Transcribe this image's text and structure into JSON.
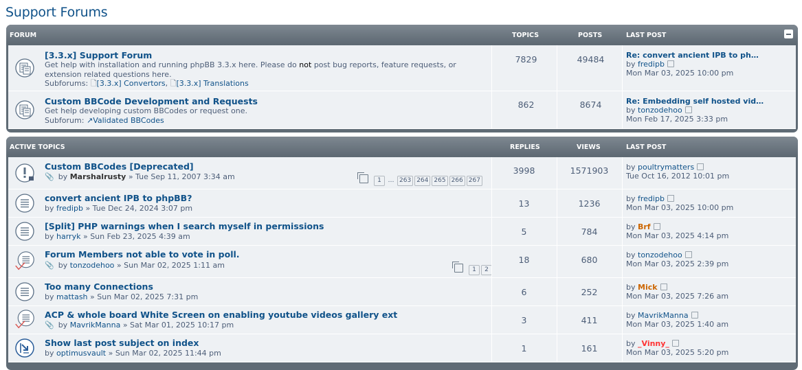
{
  "page": {
    "title": "Support Forums"
  },
  "forums_panel": {
    "headers": {
      "forum": "FORUM",
      "topics": "TOPICS",
      "posts": "POSTS",
      "last_post": "LAST POST"
    },
    "rows": [
      {
        "title": "[3.3.x] Support Forum",
        "desc1": "Get help with installation and running phpBB 3.3.x here. Please do",
        "desc_not": "not",
        "desc1b": "post bug reports, feature requests, or",
        "desc2": "extension related questions here.",
        "sub_label": "Subforums:",
        "sub1": "[3.3.x] Convertors",
        "sub_sep": ",",
        "sub2": "[3.3.x] Translations",
        "topics": "7829",
        "posts": "49484",
        "lp_title": "Re: convert ancient IPB to ph…",
        "lp_by": "by",
        "lp_user": "fredipb",
        "lp_date": "Mon Mar 03, 2025 10:00 pm"
      },
      {
        "title": "Custom BBCode Development and Requests",
        "desc1": "Get help developing custom BBCodes or request one.",
        "sub_label": "Subforum:",
        "sub1": "Validated BBCodes",
        "topics": "862",
        "posts": "8674",
        "lp_title": "Re: Embedding self hosted vid…",
        "lp_by": "by",
        "lp_user": "tonzodehoo",
        "lp_date": "Mon Feb 17, 2025 3:33 pm"
      }
    ]
  },
  "topics_panel": {
    "headers": {
      "active": "ACTIVE TOPICS",
      "replies": "REPLIES",
      "views": "VIEWS",
      "last_post": "LAST POST"
    },
    "rows": [
      {
        "title": "Custom BBCodes [Deprecated]",
        "by": "by",
        "author": "Marshalrusty",
        "sep": "»",
        "date": "Tue Sep 11, 2007 3:34 am",
        "pages": [
          "1",
          "…",
          "263",
          "264",
          "265",
          "266",
          "267"
        ],
        "replies": "3998",
        "views": "1571903",
        "lp_by": "by",
        "lp_user": "poultrymatters",
        "lp_date": "Tue Oct 16, 2012 10:01 pm"
      },
      {
        "title": "convert ancient IPB to phpBB?",
        "by": "by",
        "author": "fredipb",
        "sep": "»",
        "date": "Tue Dec 24, 2024 3:07 pm",
        "replies": "13",
        "views": "1236",
        "lp_by": "by",
        "lp_user": "fredipb",
        "lp_date": "Mon Mar 03, 2025 10:00 pm"
      },
      {
        "title": "[Split] PHP warnings when I search myself in permissions",
        "by": "by",
        "author": "harryk",
        "sep": "»",
        "date": "Sun Feb 23, 2025 4:39 am",
        "replies": "5",
        "views": "784",
        "lp_by": "by",
        "lp_user": "Brf",
        "lp_date": "Mon Mar 03, 2025 4:14 pm"
      },
      {
        "title": "Forum Members not able to vote in poll.",
        "by": "by",
        "author": "tonzodehoo",
        "sep": "»",
        "date": "Sun Mar 02, 2025 1:11 am",
        "pages": [
          "1",
          "2"
        ],
        "replies": "18",
        "views": "680",
        "lp_by": "by",
        "lp_user": "tonzodehoo",
        "lp_date": "Mon Mar 03, 2025 2:39 pm"
      },
      {
        "title": "Too many Connections",
        "by": "by",
        "author": "mattash",
        "sep": "»",
        "date": "Sun Mar 02, 2025 7:31 pm",
        "replies": "6",
        "views": "252",
        "lp_by": "by",
        "lp_user": "Mick",
        "lp_date": "Mon Mar 03, 2025 7:26 am"
      },
      {
        "title": "ACP & whole board White Screen on enabling youtube videos gallery ext",
        "by": "by",
        "author": "MavrikManna",
        "sep": "»",
        "date": "Sat Mar 01, 2025 10:17 pm",
        "replies": "3",
        "views": "411",
        "lp_by": "by",
        "lp_user": "MavrikManna",
        "lp_date": "Mon Mar 03, 2025 1:40 am"
      },
      {
        "title": "Show last post subject on index",
        "by": "by",
        "author": "optimusvault",
        "sep": "»",
        "date": "Sun Mar 02, 2025 11:44 pm",
        "replies": "1",
        "views": "161",
        "lp_by": "by",
        "lp_user": "_Vinny_",
        "lp_date": "Mon Mar 03, 2025 5:20 pm"
      }
    ]
  },
  "colors": {
    "link": "#105289",
    "header_bg": "#5d6872",
    "row_bg": "#eef1f4",
    "moderator": "#CC6600",
    "admin": "#ff3333"
  },
  "icons": {
    "forum": "forum-read-icon",
    "topic": "topic-read-icon",
    "sticky": "sticky-locked-icon",
    "poll": "poll-icon",
    "moved": "moved-topic-icon"
  }
}
